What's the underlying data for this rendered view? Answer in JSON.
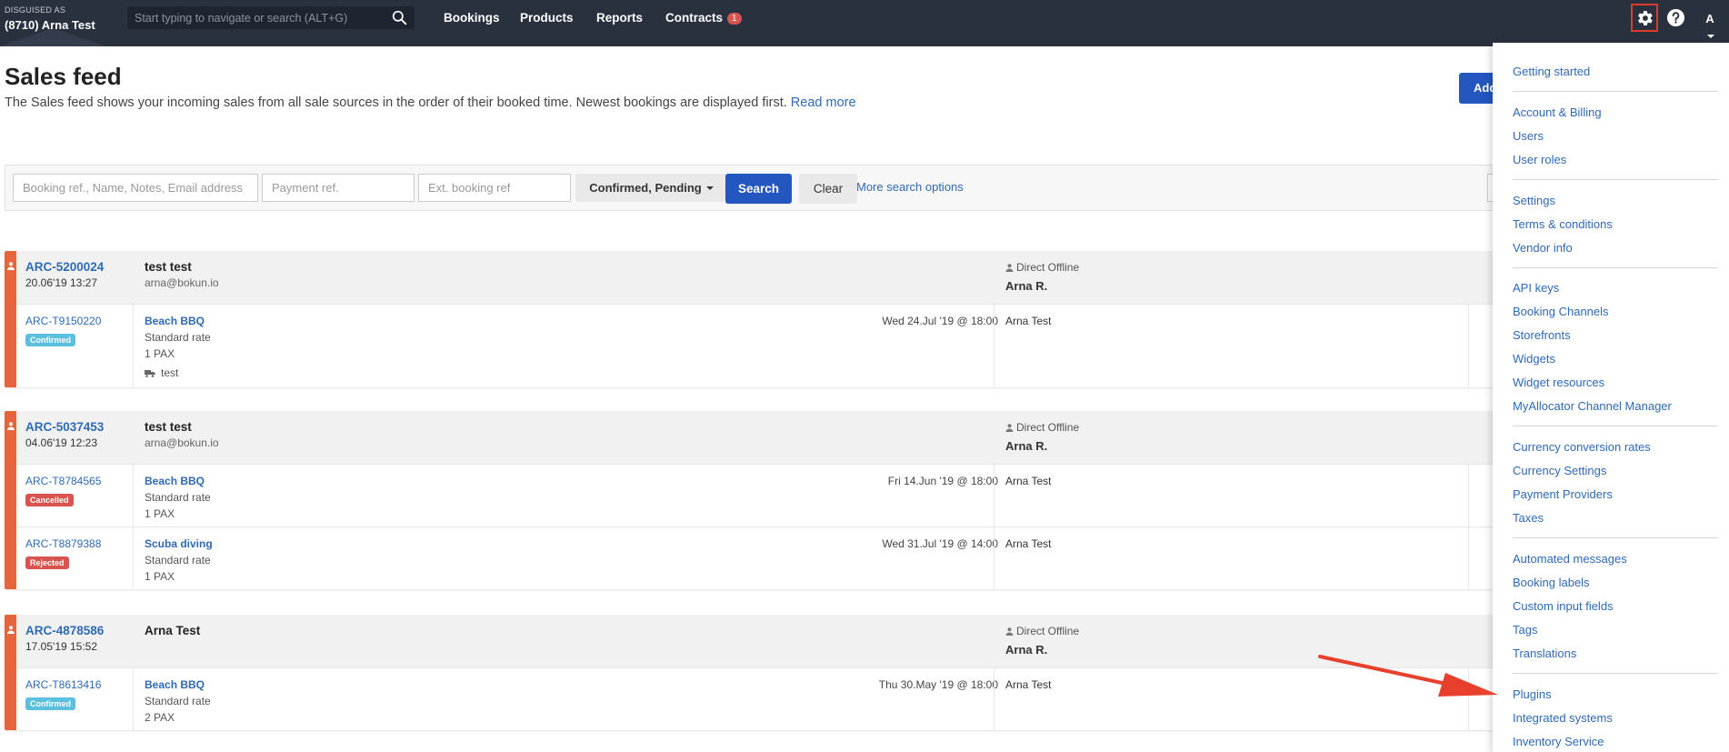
{
  "topbar": {
    "disguised_label": "DISGUISED AS",
    "account": "(8710) Arna Test",
    "search_placeholder": "Start typing to navigate or search (ALT+G)",
    "nav": [
      {
        "label": "Bookings"
      },
      {
        "label": "Products"
      },
      {
        "label": "Reports"
      },
      {
        "label": "Contracts",
        "badge": "1"
      }
    ],
    "avatar": "A"
  },
  "page": {
    "title": "Sales feed",
    "description": "The Sales feed shows your incoming sales from all sale sources in the order of their booked time. Newest bookings are displayed first.",
    "read_more": "Read more",
    "add_button": "Add"
  },
  "filters": {
    "booking_ref_placeholder": "Booking ref., Name, Notes, Email address",
    "payment_ref_placeholder": "Payment ref.",
    "ext_ref_placeholder": "Ext. booking ref",
    "status_value": "Confirmed, Pending",
    "search_label": "Search",
    "clear_label": "Clear",
    "more_options": "More search options"
  },
  "bookings": [
    {
      "ref": "ARC-5200024",
      "date": "20.06'19 13:27",
      "customer": "test test",
      "email": "arna@bokun.io",
      "channel": "Direct Offline",
      "seller": "Arna R.",
      "lines": [
        {
          "ref": "ARC-T9150220",
          "status": "Confirmed",
          "product": "Beach BBQ",
          "rate": "Standard rate",
          "pax": "1 PAX",
          "note": "test",
          "date": "Wed 24.Jul '19 @ 18:00",
          "guest": "Arna Test"
        }
      ]
    },
    {
      "ref": "ARC-5037453",
      "date": "04.06'19 12:23",
      "customer": "test test",
      "email": "arna@bokun.io",
      "channel": "Direct Offline",
      "seller": "Arna R.",
      "lines": [
        {
          "ref": "ARC-T8784565",
          "status": "Cancelled",
          "product": "Beach BBQ",
          "rate": "Standard rate",
          "pax": "1 PAX",
          "date": "Fri 14.Jun '19 @ 18:00",
          "guest": "Arna Test"
        },
        {
          "ref": "ARC-T8879388",
          "status": "Rejected",
          "product": "Scuba diving",
          "rate": "Standard rate",
          "pax": "1 PAX",
          "date": "Wed 31.Jul '19 @ 14:00",
          "guest": "Arna Test"
        }
      ]
    },
    {
      "ref": "ARC-4878586",
      "date": "17.05'19 15:52",
      "customer": "Arna Test",
      "email": "",
      "channel": "Direct Offline",
      "seller": "Arna R.",
      "lines": [
        {
          "ref": "ARC-T8613416",
          "status": "Confirmed",
          "product": "Beach BBQ",
          "rate": "Standard rate",
          "pax": "2 PAX",
          "date": "Thu 30.May '19 @ 18:00",
          "guest": "Arna Test"
        }
      ]
    }
  ],
  "settings_menu": [
    [
      "Getting started"
    ],
    [
      "Account & Billing",
      "Users",
      "User roles"
    ],
    [
      "Settings",
      "Terms & conditions",
      "Vendor info"
    ],
    [
      "API keys",
      "Booking Channels",
      "Storefronts",
      "Widgets",
      "Widget resources",
      "MyAllocator Channel Manager"
    ],
    [
      "Currency conversion rates",
      "Currency Settings",
      "Payment Providers",
      "Taxes"
    ],
    [
      "Automated messages",
      "Booking labels",
      "Custom input fields",
      "Tags",
      "Translations"
    ],
    [
      "Plugins",
      "Integrated systems",
      "Inventory Service"
    ]
  ],
  "colors": {
    "topbar": "#2a313e",
    "primary": "#2456bf",
    "link": "#2f6ab5",
    "strip": "#e8643c",
    "confirmed": "#5bc0de",
    "cancelled": "#d9534f",
    "rejected": "#d9534f",
    "highlight": "#e03a2c"
  },
  "icons": {
    "search": "search-icon",
    "settings": "gear-icon",
    "help": "help-icon",
    "person": "person-icon",
    "annotation": "red-arrow"
  }
}
